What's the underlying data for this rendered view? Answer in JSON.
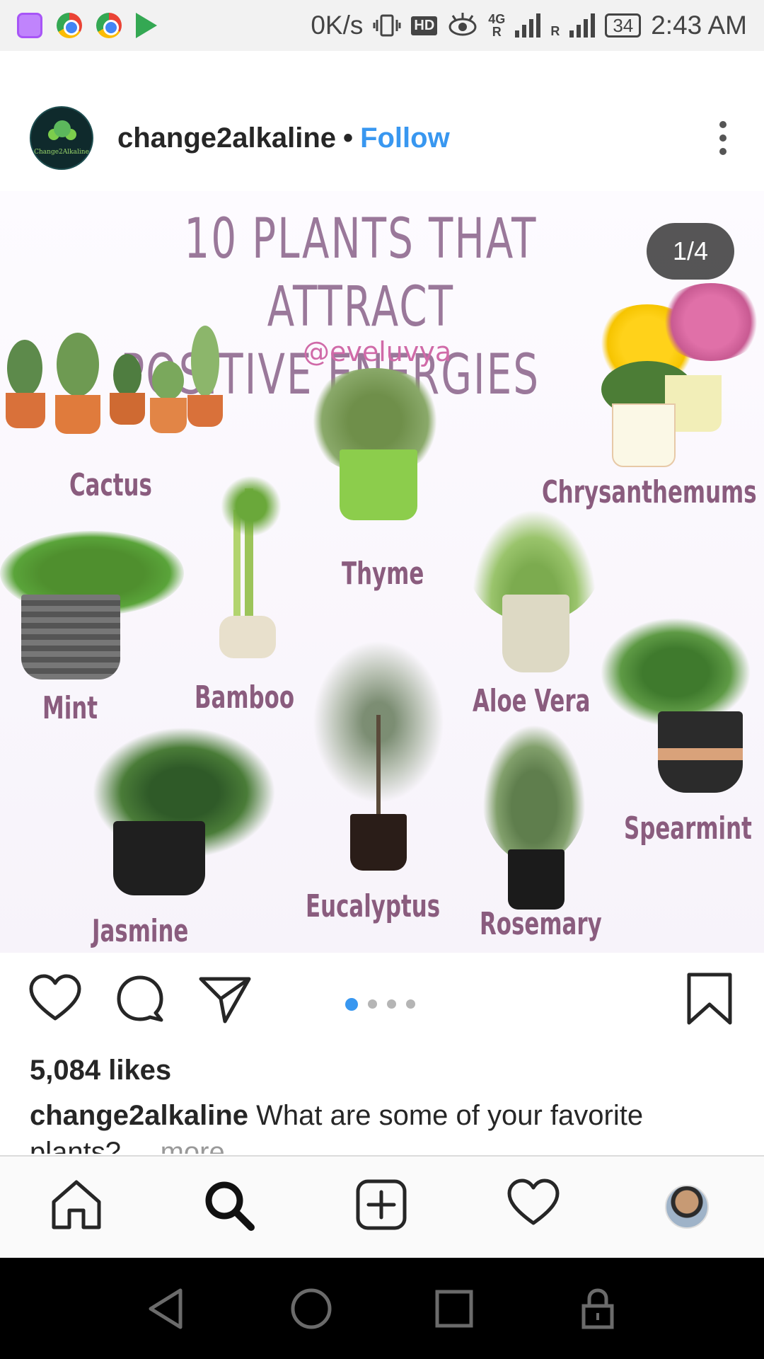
{
  "status_bar": {
    "network_speed": "0K/s",
    "hd_badge": "HD",
    "network_type": "4G",
    "roaming_marker": "R",
    "battery": "34",
    "time": "2:43 AM",
    "app_icons": [
      "gallery-icon",
      "chrome-icon",
      "chrome-icon",
      "play-store-icon"
    ]
  },
  "post": {
    "username": "change2alkaline",
    "separator": "•",
    "follow_label": "Follow",
    "avatar_text": "Change2Alkaline",
    "image": {
      "title_line1": "10 PLANTS THAT ATTRACT",
      "title_line2": "POSITIVE ENERGIES",
      "handle": "@eveluvya",
      "counter": "1/4",
      "labels": {
        "cactus": "Cactus",
        "thyme": "Thyme",
        "chrysanthemums": "Chrysanthemums",
        "mint": "Mint",
        "bamboo": "Bamboo",
        "aloe_vera": "Aloe Vera",
        "spearmint": "Spearmint",
        "jasmine": "Jasmine",
        "eucalyptus": "Eucalyptus",
        "rosemary": "Rosemary"
      }
    },
    "carousel": {
      "total": 4,
      "current": 1
    },
    "likes": "5,084 likes",
    "caption_user": "change2alkaline",
    "caption_text": "What are some of your favorite plants?",
    "caption_more": "... more"
  },
  "bottom_nav": [
    "home-icon",
    "search-icon",
    "new-post-icon",
    "activity-heart-icon",
    "profile-avatar"
  ],
  "colors": {
    "follow_blue": "#3897f0",
    "text_dark": "#262626",
    "label_purple": "#8a5c7e",
    "title_purple": "#9a789a"
  }
}
